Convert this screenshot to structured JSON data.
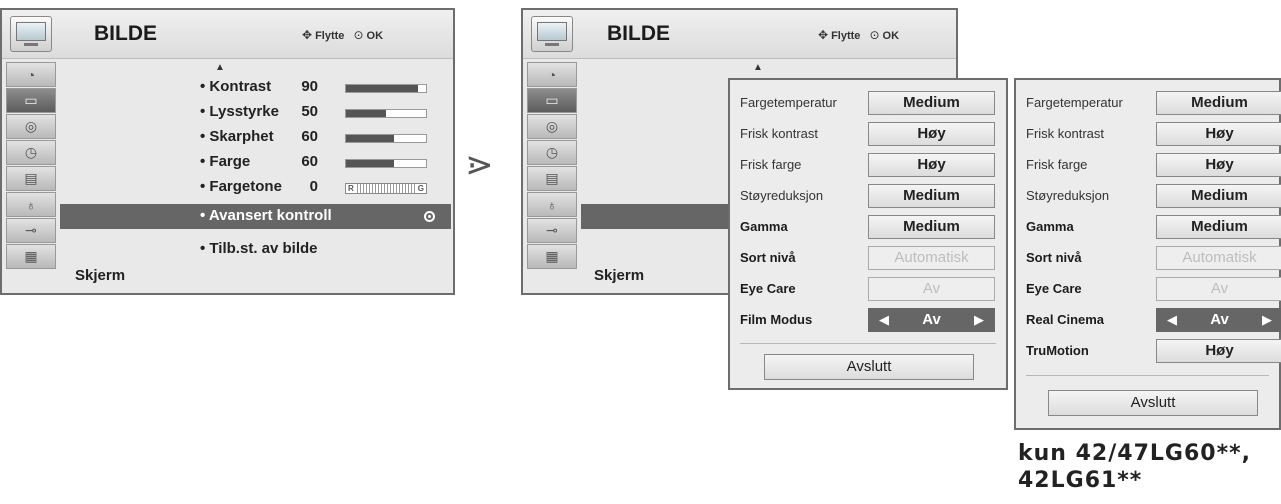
{
  "left_panel": {
    "title": "BILDE",
    "nav_hint": "Flytte",
    "ok_hint": "OK",
    "items": [
      {
        "label": "• Kontrast",
        "value": "90",
        "level": 90
      },
      {
        "label": "• Lysstyrke",
        "value": "50",
        "level": 50
      },
      {
        "label": "• Skarphet",
        "value": "60",
        "level": 60
      },
      {
        "label": "• Farge",
        "value": "60",
        "level": 60
      },
      {
        "label": "• Fargetone",
        "value": "0",
        "tint_left": "R",
        "tint_right": "G"
      }
    ],
    "selected_item": "• Avansert kontroll",
    "last_item": "• Tilb.st. av bilde",
    "footer": "Skjerm"
  },
  "middle_panel": {
    "title": "BILDE",
    "nav_hint": "Flytte",
    "ok_hint": "OK",
    "footer": "Skjerm"
  },
  "popup_a": {
    "rows": [
      {
        "label": "Fargetemperatur",
        "value": "Medium"
      },
      {
        "label": "Frisk kontrast",
        "value": "Høy"
      },
      {
        "label": "Frisk farge",
        "value": "Høy"
      },
      {
        "label": "Støyreduksjon",
        "value": "Medium"
      },
      {
        "label": "Gamma",
        "value": "Medium"
      },
      {
        "label": "Sort nivå",
        "value": "Automatisk"
      },
      {
        "label": "Eye Care",
        "value": "Av"
      },
      {
        "label": "Film Modus",
        "value": "Av"
      }
    ],
    "exit": "Avslutt"
  },
  "popup_b": {
    "rows": [
      {
        "label": "Fargetemperatur",
        "value": "Medium"
      },
      {
        "label": "Frisk kontrast",
        "value": "Høy"
      },
      {
        "label": "Frisk farge",
        "value": "Høy"
      },
      {
        "label": "Støyreduksjon",
        "value": "Medium"
      },
      {
        "label": "Gamma",
        "value": "Medium"
      },
      {
        "label": "Sort nivå",
        "value": "Automatisk"
      },
      {
        "label": "Eye Care",
        "value": "Av"
      },
      {
        "label": "Real Cinema",
        "value": "Av"
      },
      {
        "label": "TruMotion",
        "value": "Høy"
      }
    ],
    "exit": "Avslutt"
  },
  "note_line1": "kun 42/47LG60**,",
  "note_line2": "42LG61**",
  "separator_glyph": "⋗"
}
